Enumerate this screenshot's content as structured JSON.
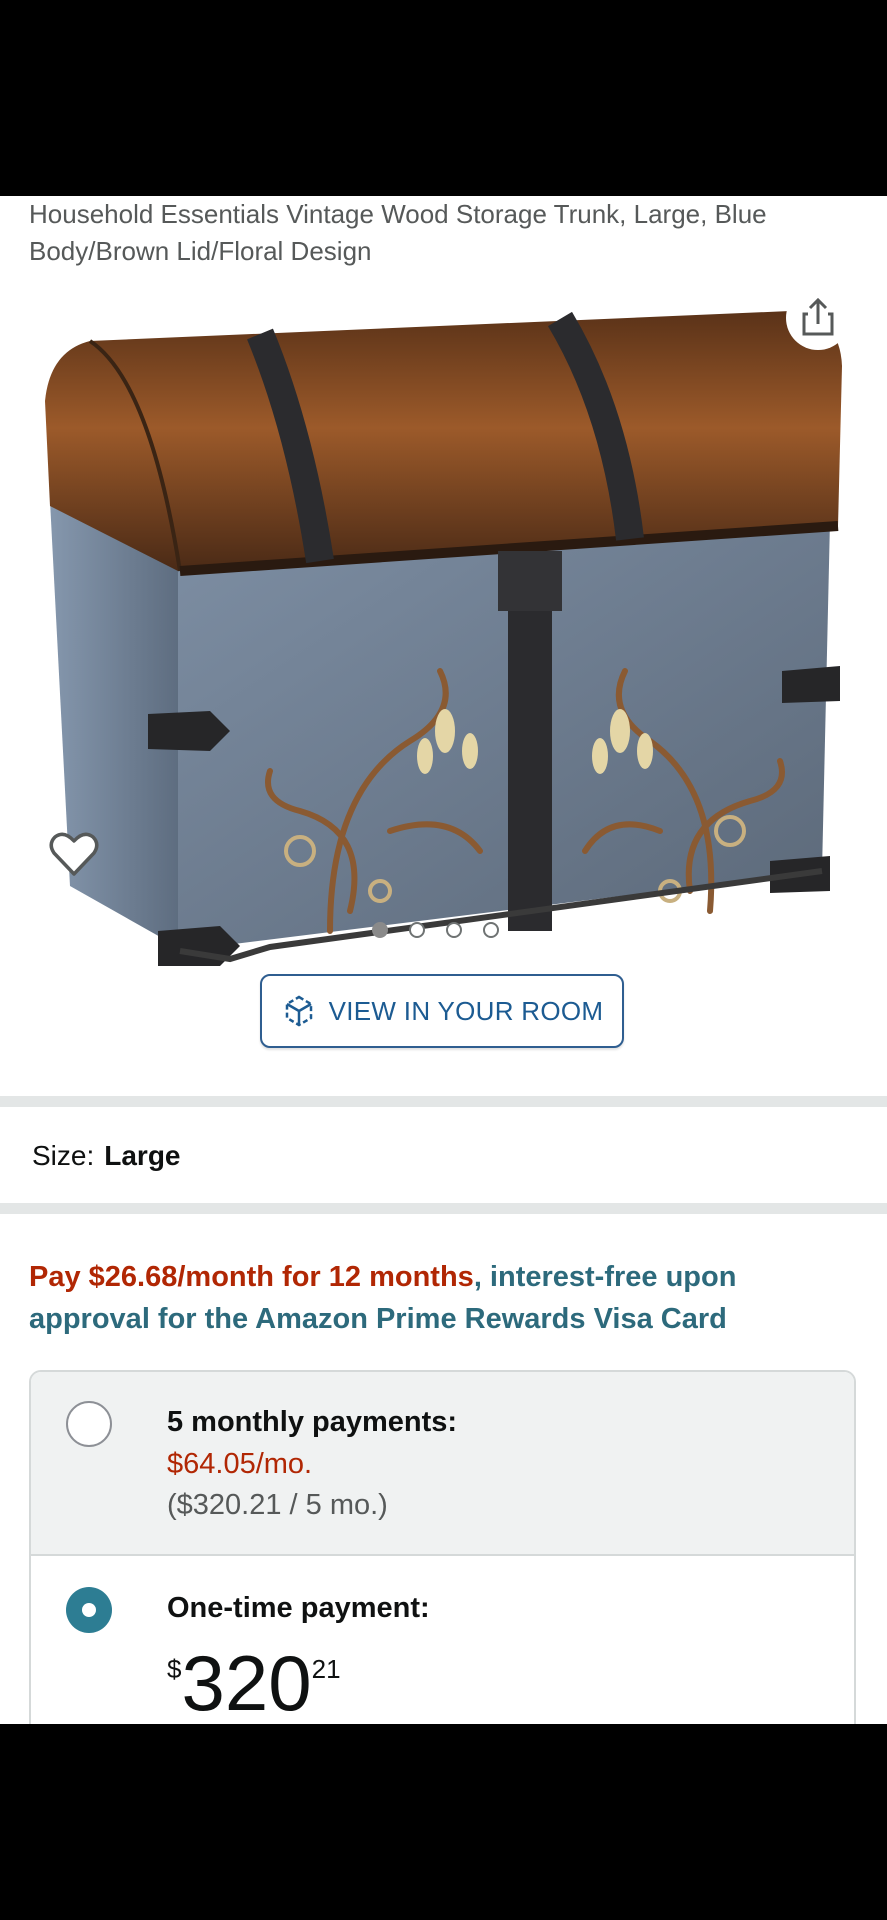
{
  "product": {
    "title": "Household Essentials Vintage Wood Storage Trunk, Large, Blue Body/Brown Lid/Floral Design",
    "image_dots": {
      "count": 4,
      "active_index": 0
    }
  },
  "view_in_room": {
    "label": "VIEW IN YOUR ROOM"
  },
  "size": {
    "label": "Size:",
    "value": "Large"
  },
  "promo": {
    "highlight": "Pay $26.68/month for 12 months",
    "rest": ", interest-free upon approval for the Amazon Prime Rewards Visa Card"
  },
  "payment_options": {
    "monthly": {
      "label": "5 monthly payments:",
      "per_month": "$64.05/mo.",
      "total": "($320.21 / 5 mo.)",
      "selected": false
    },
    "one_time": {
      "label": "One-time payment:",
      "currency": "$",
      "whole": "320",
      "fraction": "21",
      "selected": true
    }
  },
  "icons": {
    "share": "share-icon",
    "wishlist": "heart-icon",
    "ar": "ar-cube-icon",
    "chat": "alexa-chat-icon"
  }
}
